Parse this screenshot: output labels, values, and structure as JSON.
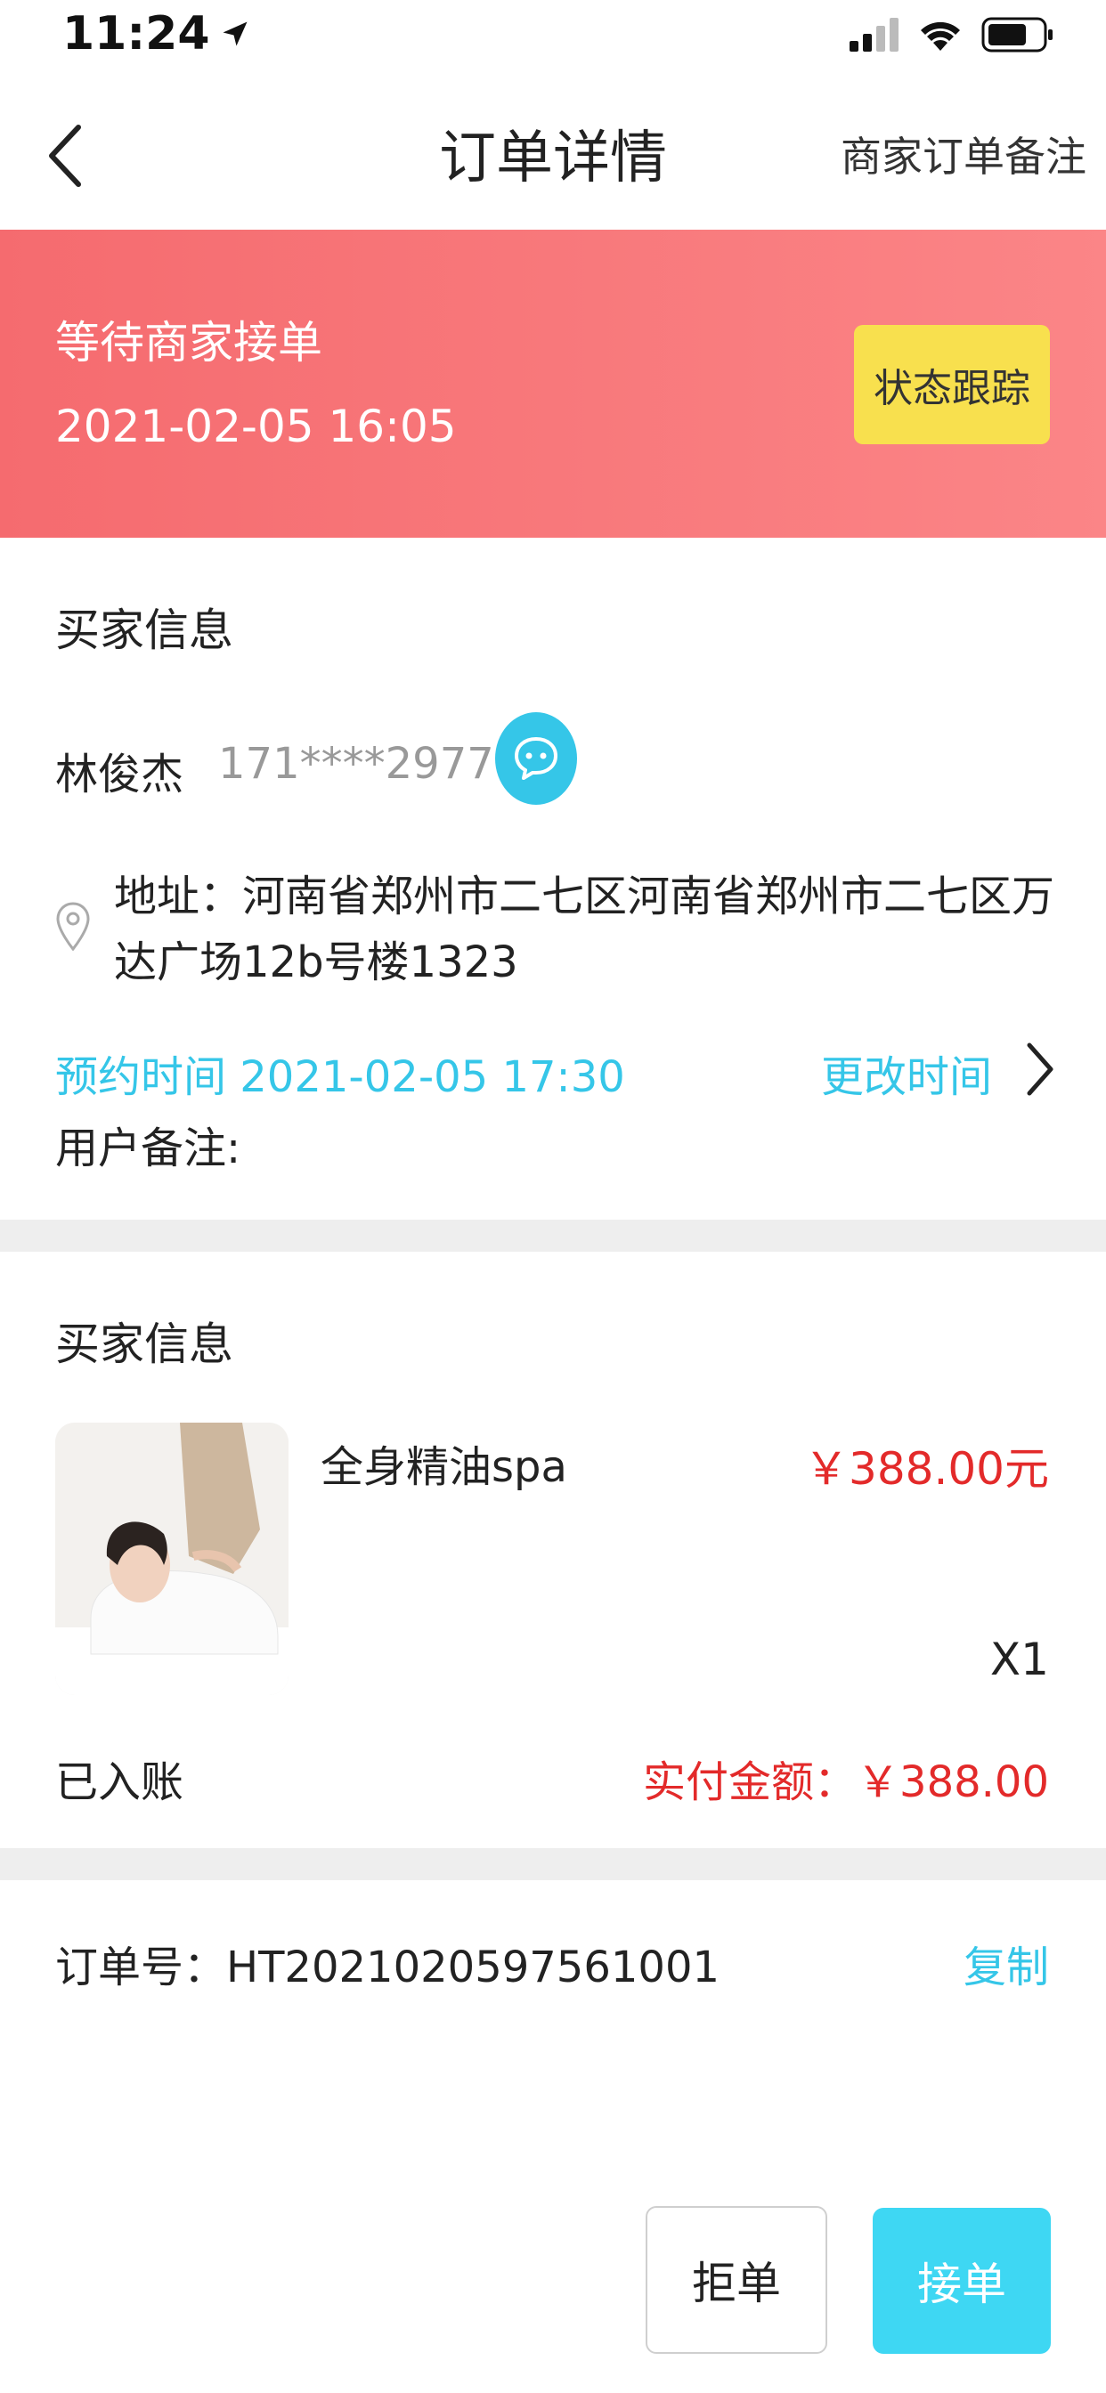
{
  "status_bar": {
    "time": "11:24"
  },
  "nav": {
    "title": "订单详情",
    "right_action": "商家订单备注"
  },
  "banner": {
    "status": "等待商家接单",
    "time": "2021-02-05 16:05",
    "track_button": "状态跟踪"
  },
  "buyer": {
    "section_title": "买家信息",
    "name": "林俊杰",
    "phone": "171****2977",
    "address": "地址：河南省郑州市二七区河南省郑州市二七区万达广场12b号楼1323",
    "appointment": "预约时间 2021-02-05 17:30",
    "change_time": "更改时间",
    "remark_label": "用户备注:"
  },
  "product": {
    "section_title": "买家信息",
    "name": "全身精油spa",
    "price": "￥388.00元",
    "quantity": "X1",
    "account_status": "已入账",
    "paid_amount": "实付金额：￥388.00"
  },
  "order": {
    "number": "订单号：HT2021020597561001",
    "copy_label": "复制"
  },
  "actions": {
    "reject": "拒单",
    "accept": "接单"
  },
  "colors": {
    "banner_start": "#f56b6f",
    "banner_end": "#fb8587",
    "accent": "#35c6e8",
    "price": "#e32a2a",
    "track_button": "#f8e04e"
  }
}
